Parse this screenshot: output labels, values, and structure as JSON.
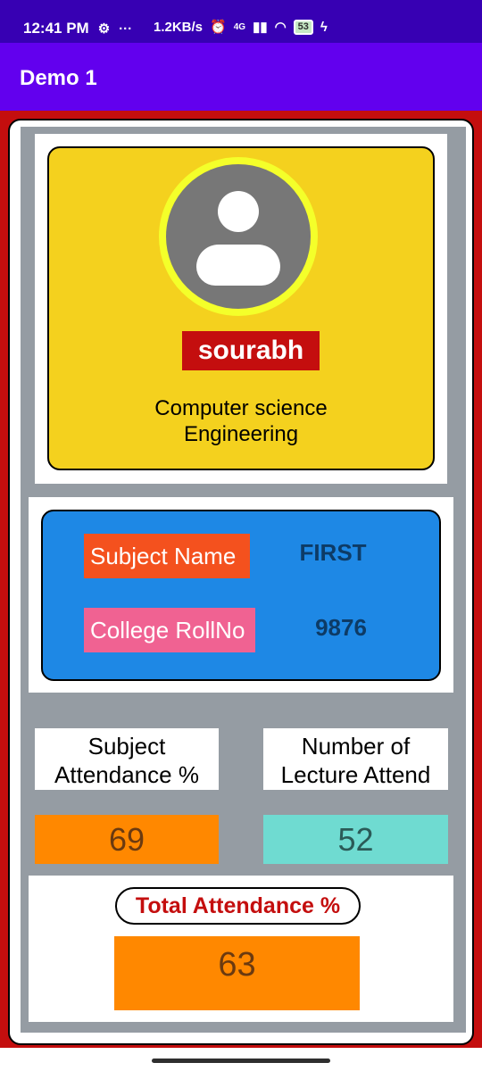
{
  "status_bar": {
    "time": "12:41 PM",
    "settings_icon": "gear-icon",
    "more": "···",
    "net_speed": "1.2KB/s",
    "network": "4G",
    "battery": "53"
  },
  "app_bar": {
    "title": "Demo 1"
  },
  "profile": {
    "avatar_icon": "person-icon",
    "name": "sourabh",
    "department_line1": "Computer science",
    "department_line2": "Engineering"
  },
  "info": {
    "subject_label": "Subject Name",
    "subject_value": "FIRST",
    "roll_label": "College RollNo",
    "roll_value": "9876"
  },
  "stats": {
    "attendance_label_line1": "Subject",
    "attendance_label_line2": "Attendance %",
    "attendance_value": "69",
    "lecture_label_line1": "Number of",
    "lecture_label_line2": "Lecture Attend",
    "lecture_value": "52"
  },
  "total": {
    "label": "Total Attendance %",
    "value": "63"
  },
  "colors": {
    "status_bar": "#3700b3",
    "app_bar": "#6200ee",
    "frame": "#c40e0e",
    "profile_card": "#f4d11e",
    "info_card": "#1e88e5",
    "subject_chip": "#f4511e",
    "roll_chip": "#f06292",
    "attendance": "#ff8800",
    "lecture": "#6fdbd1"
  }
}
